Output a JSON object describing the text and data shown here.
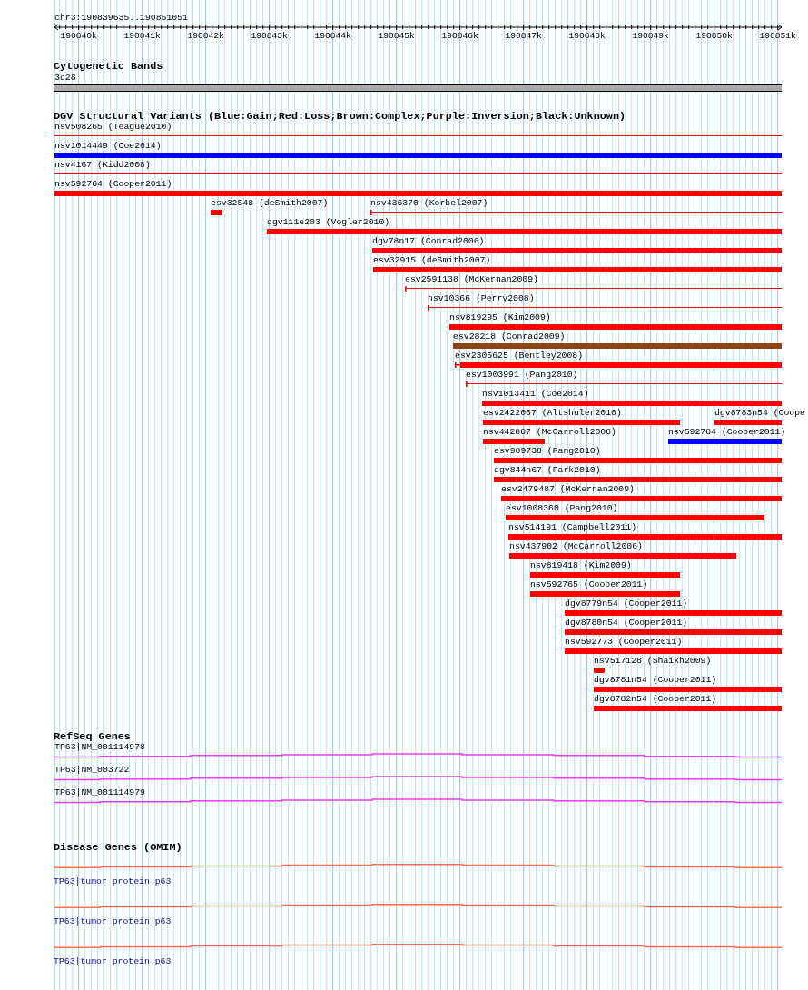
{
  "ruler": {
    "region": "chr3:190839635..190851051",
    "ticks": [
      "190840k",
      "190841k",
      "190842k",
      "190843k",
      "190844k",
      "190845k",
      "190846k",
      "190847k",
      "190848k",
      "190849k",
      "190850k",
      "190851k"
    ]
  },
  "cytogenetic_bands": {
    "title": "Cytogenetic Bands",
    "bands": [
      {
        "label": "3q28"
      }
    ]
  },
  "dgv_track": {
    "title": "DGV Structural Variants (Blue:Gain;Red:Loss;Brown:Complex;Purple:Inversion;Black:Unknown)",
    "rows": [
      {
        "features": [
          {
            "label": "nsv508265 (Teague2010)",
            "kind": "line",
            "color": "#ff0000"
          }
        ]
      },
      {
        "features": [
          {
            "label": "nsv1014449 (Coe2014)",
            "kind": "bar",
            "color": "#0000ff"
          }
        ]
      },
      {
        "features": [
          {
            "label": "nsv4167 (Kidd2008)",
            "kind": "line",
            "color": "#ff0000"
          }
        ]
      },
      {
        "features": [
          {
            "label": "nsv592764 (Cooper2011)",
            "kind": "bar",
            "color": "#ff0000"
          }
        ]
      },
      {
        "features": [
          {
            "label": "esv32548 (deSmith2007)",
            "kind": "bar",
            "color": "#ff0000"
          },
          {
            "label": "nsv436370 (Korbel2007)",
            "kind": "line",
            "color": "#ff0000"
          }
        ]
      },
      {
        "features": [
          {
            "label": "dgv111e203 (Vogler2010)",
            "kind": "bar",
            "color": "#ff0000"
          }
        ]
      },
      {
        "features": [
          {
            "label": "dgv78n17 (Conrad2006)",
            "kind": "bar",
            "color": "#ff0000"
          }
        ]
      },
      {
        "features": [
          {
            "label": "esv32915 (deSmith2007)",
            "kind": "bar",
            "color": "#ff0000"
          }
        ]
      },
      {
        "features": [
          {
            "label": "esv2591138 (McKernan2009)",
            "kind": "line",
            "color": "#ff0000"
          }
        ]
      },
      {
        "features": [
          {
            "label": "nsv10366 (Perry2008)",
            "kind": "line",
            "color": "#ff0000"
          }
        ]
      },
      {
        "features": [
          {
            "label": "nsv819295 (Kim2009)",
            "kind": "bar",
            "color": "#ff0000"
          }
        ]
      },
      {
        "features": [
          {
            "label": "esv28218 (Conrad2009)",
            "kind": "bar",
            "color": "#8b4513"
          }
        ]
      },
      {
        "features": [
          {
            "label": "esv2305625 (Bentley2008)",
            "kind": "tick_bar",
            "color": "#ff0000"
          }
        ]
      },
      {
        "features": [
          {
            "label": "esv1003991 (Pang2010)",
            "kind": "line",
            "color": "#ff0000"
          }
        ]
      },
      {
        "features": [
          {
            "label": "nsv1013411 (Coe2014)",
            "kind": "bar",
            "color": "#ff0000"
          }
        ]
      },
      {
        "features": [
          {
            "label": "esv2422067 (Altshuler2010)",
            "kind": "bar",
            "color": "#ff0000"
          },
          {
            "label": "dgv8783n54 (Coope",
            "kind": "bar",
            "color": "#ff0000"
          }
        ]
      },
      {
        "features": [
          {
            "label": "nsv442887 (McCarroll2008)",
            "kind": "bar",
            "color": "#ff0000"
          },
          {
            "label": "nsv592784 (Cooper2011)",
            "kind": "bar",
            "color": "#0000ff"
          }
        ]
      },
      {
        "features": [
          {
            "label": "esv989738 (Pang2010)",
            "kind": "bar",
            "color": "#ff0000"
          }
        ]
      },
      {
        "features": [
          {
            "label": "dgv844n67 (Park2010)",
            "kind": "bar",
            "color": "#ff0000"
          }
        ]
      },
      {
        "features": [
          {
            "label": "esv2479487 (McKernan2009)",
            "kind": "bar",
            "color": "#ff0000"
          }
        ]
      },
      {
        "features": [
          {
            "label": "esv1008360 (Pang2010)",
            "kind": "bar",
            "color": "#ff0000"
          }
        ]
      },
      {
        "features": [
          {
            "label": "nsv514191 (Campbell2011)",
            "kind": "bar",
            "color": "#ff0000"
          }
        ]
      },
      {
        "features": [
          {
            "label": "nsv437902 (McCarroll2006)",
            "kind": "bar",
            "color": "#ff0000"
          }
        ]
      },
      {
        "features": [
          {
            "label": "nsv819418 (Kim2009)",
            "kind": "bar",
            "color": "#ff0000"
          }
        ]
      },
      {
        "features": [
          {
            "label": "nsv592765 (Cooper2011)",
            "kind": "bar",
            "color": "#ff0000"
          }
        ]
      },
      {
        "features": [
          {
            "label": "dgv8779n54 (Cooper2011)",
            "kind": "bar",
            "color": "#ff0000"
          }
        ]
      },
      {
        "features": [
          {
            "label": "dgv8780n54 (Cooper2011)",
            "kind": "bar",
            "color": "#ff0000"
          }
        ]
      },
      {
        "features": [
          {
            "label": "nsv592773 (Cooper2011)",
            "kind": "bar",
            "color": "#ff0000"
          }
        ]
      },
      {
        "features": [
          {
            "label": "nsv517128 (Shaikh2009)",
            "kind": "bar",
            "color": "#ff0000"
          }
        ]
      },
      {
        "features": [
          {
            "label": "dgv8781n54 (Cooper2011)",
            "kind": "bar",
            "color": "#ff0000"
          }
        ]
      },
      {
        "features": [
          {
            "label": "dgv8782n54 (Cooper2011)",
            "kind": "bar",
            "color": "#ff0000"
          }
        ]
      }
    ]
  },
  "refseq_genes": {
    "title": "RefSeq Genes",
    "genes": [
      {
        "label": "TP63|NM_001114978"
      },
      {
        "label": "TP63|NM_003722"
      },
      {
        "label": "TP63|NM_001114979"
      }
    ]
  },
  "disease_genes": {
    "title": "Disease Genes (OMIM)",
    "genes": [
      {
        "label": "TP63|tumor protein p63"
      },
      {
        "label": "TP63|tumor protein p63"
      },
      {
        "label": "TP63|tumor protein p63"
      }
    ]
  }
}
